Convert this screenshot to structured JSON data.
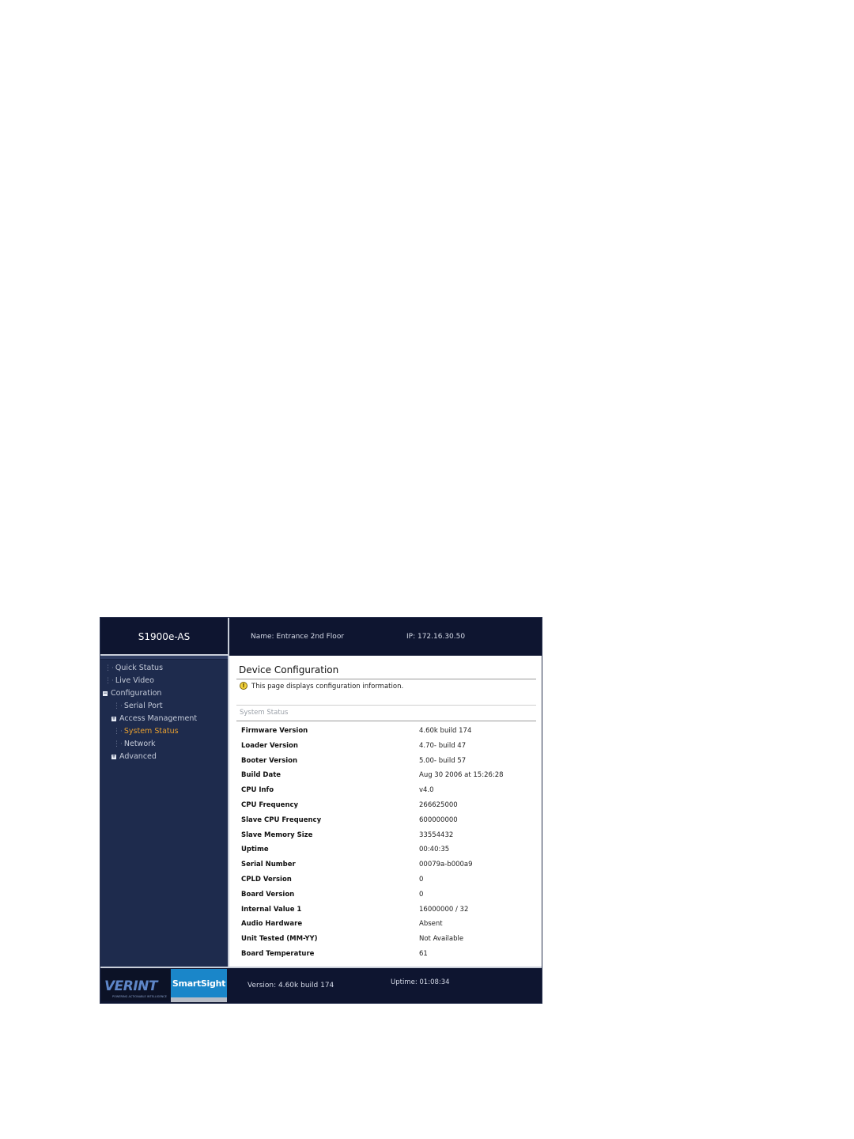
{
  "header": {
    "model": "S1900e-AS",
    "name": "Name: Entrance 2nd Floor",
    "ip": "IP: 172.16.30.50"
  },
  "sidebar": {
    "items": [
      {
        "label": "Quick Status",
        "level": 0,
        "expander": "none"
      },
      {
        "label": "Live Video",
        "level": 0,
        "expander": "none"
      },
      {
        "label": "Configuration",
        "level": 0,
        "expander": "collapse"
      },
      {
        "label": "Serial Port",
        "level": 1,
        "expander": "none"
      },
      {
        "label": "Access Management",
        "level": 1,
        "expander": "expand"
      },
      {
        "label": "System Status",
        "level": 1,
        "expander": "none",
        "active": true
      },
      {
        "label": "Network",
        "level": 1,
        "expander": "none"
      },
      {
        "label": "Advanced",
        "level": 1,
        "expander": "expand"
      }
    ]
  },
  "content": {
    "title": "Device Configuration",
    "info_icon": "warning-icon",
    "info_text": "This page displays configuration information.",
    "section_title": "System Status",
    "rows": [
      {
        "label": "Firmware Version",
        "value": "4.60k build 174"
      },
      {
        "label": "Loader Version",
        "value": "4.70- build 47"
      },
      {
        "label": "Booter Version",
        "value": "5.00- build 57"
      },
      {
        "label": "Build Date",
        "value": "Aug 30 2006 at 15:26:28"
      },
      {
        "label": "CPU Info",
        "value": "v4.0"
      },
      {
        "label": "CPU Frequency",
        "value": "266625000"
      },
      {
        "label": "Slave CPU Frequency",
        "value": "600000000"
      },
      {
        "label": "Slave Memory Size",
        "value": "33554432"
      },
      {
        "label": "Uptime",
        "value": "00:40:35"
      },
      {
        "label": "Serial Number",
        "value": "00079a-b000a9"
      },
      {
        "label": "CPLD Version",
        "value": "0"
      },
      {
        "label": "Board Version",
        "value": "0"
      },
      {
        "label": "Internal Value 1",
        "value": "16000000 / 32"
      },
      {
        "label": "Audio Hardware",
        "value": "Absent"
      },
      {
        "label": "Unit Tested (MM-YY)",
        "value": "Not Available"
      },
      {
        "label": "Board Temperature",
        "value": "61"
      }
    ]
  },
  "footer": {
    "logo_text": "VERINT",
    "logo_tagline": "POWERING ACTIONABLE INTELLIGENCE",
    "product_text": "SmartSight",
    "version": "Version: 4.60k build 174",
    "uptime": "Uptime: 01:08:34"
  },
  "colors": {
    "frame": "#0e1530",
    "sidebar": "#1e2b4d",
    "active_nav": "#e8a030",
    "smartsight_blue": "#1a86c9"
  }
}
